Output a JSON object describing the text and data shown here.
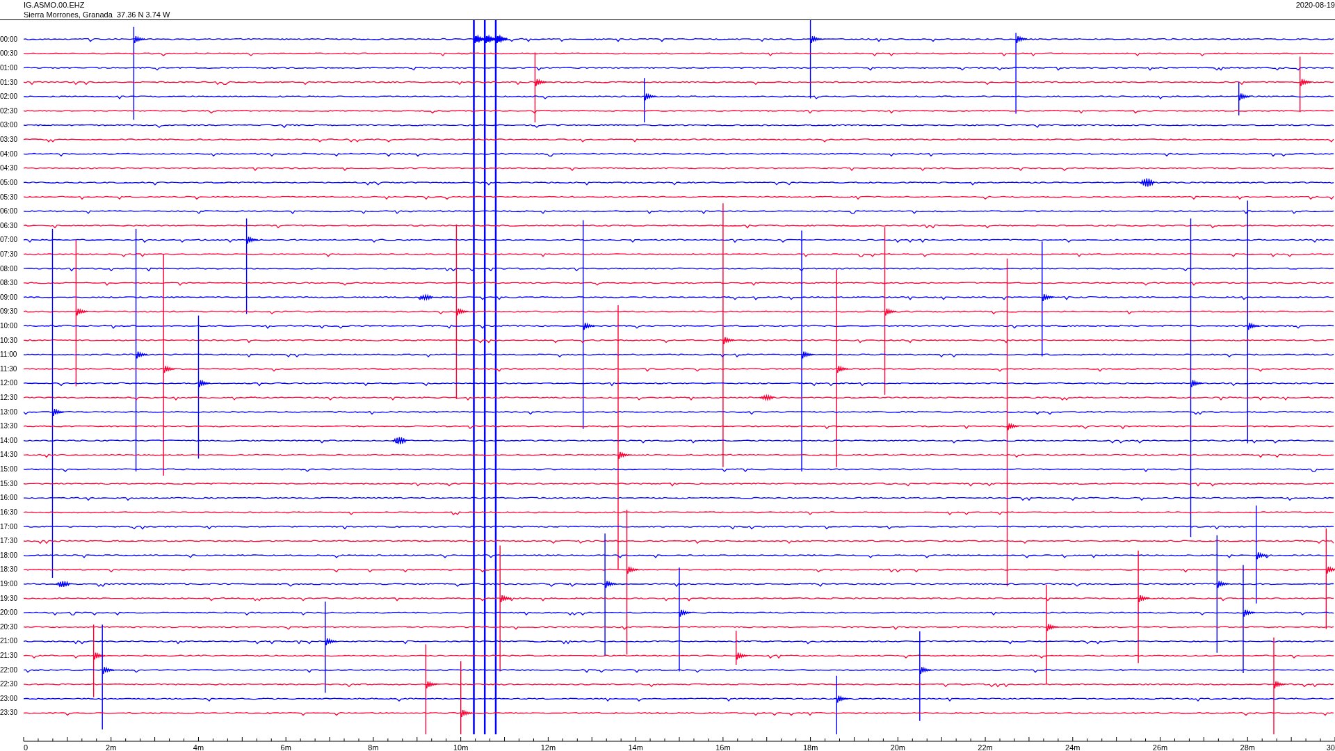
{
  "header": {
    "station": "IG.ASMO.00.EHZ",
    "location": "Sierra Morrones, Granada  37.36 N 3.74 W",
    "date": "2020-08-19"
  },
  "rows": [
    {
      "label": "00:00",
      "color": "#0000ff"
    },
    {
      "label": "00:30",
      "color": "#ff0033"
    },
    {
      "label": "01:00",
      "color": "#0000ff"
    },
    {
      "label": "01:30",
      "color": "#ff0033"
    },
    {
      "label": "02:00",
      "color": "#0000ff"
    },
    {
      "label": "02:30",
      "color": "#ff0033"
    },
    {
      "label": "03:00",
      "color": "#0000ff"
    },
    {
      "label": "03:30",
      "color": "#ff0033"
    },
    {
      "label": "04:00",
      "color": "#0000ff"
    },
    {
      "label": "04:30",
      "color": "#ff0033"
    },
    {
      "label": "05:00",
      "color": "#0000ff"
    },
    {
      "label": "05:30",
      "color": "#ff0033"
    },
    {
      "label": "06:00",
      "color": "#0000ff"
    },
    {
      "label": "06:30",
      "color": "#ff0033"
    },
    {
      "label": "07:00",
      "color": "#0000ff"
    },
    {
      "label": "07:30",
      "color": "#ff0033"
    },
    {
      "label": "08:00",
      "color": "#0000ff"
    },
    {
      "label": "08:30",
      "color": "#ff0033"
    },
    {
      "label": "09:00",
      "color": "#0000ff"
    },
    {
      "label": "09:30",
      "color": "#ff0033"
    },
    {
      "label": "10:00",
      "color": "#0000ff"
    },
    {
      "label": "10:30",
      "color": "#ff0033"
    },
    {
      "label": "11:00",
      "color": "#0000ff"
    },
    {
      "label": "11:30",
      "color": "#ff0033"
    },
    {
      "label": "12:00",
      "color": "#0000ff"
    },
    {
      "label": "12:30",
      "color": "#ff0033"
    },
    {
      "label": "13:00",
      "color": "#0000ff"
    },
    {
      "label": "13:30",
      "color": "#ff0033"
    },
    {
      "label": "14:00",
      "color": "#0000ff"
    },
    {
      "label": "14:30",
      "color": "#ff0033"
    },
    {
      "label": "15:00",
      "color": "#0000ff"
    },
    {
      "label": "15:30",
      "color": "#ff0033"
    },
    {
      "label": "16:00",
      "color": "#0000ff"
    },
    {
      "label": "16:30",
      "color": "#ff0033"
    },
    {
      "label": "17:00",
      "color": "#0000ff"
    },
    {
      "label": "17:30",
      "color": "#ff0033"
    },
    {
      "label": "18:00",
      "color": "#0000ff"
    },
    {
      "label": "18:30",
      "color": "#ff0033"
    },
    {
      "label": "19:00",
      "color": "#0000ff"
    },
    {
      "label": "19:30",
      "color": "#ff0033"
    },
    {
      "label": "20:00",
      "color": "#0000ff"
    },
    {
      "label": "20:30",
      "color": "#ff0033"
    },
    {
      "label": "21:00",
      "color": "#0000ff"
    },
    {
      "label": "21:30",
      "color": "#ff0033"
    },
    {
      "label": "22:00",
      "color": "#0000ff"
    },
    {
      "label": "22:30",
      "color": "#ff0033"
    },
    {
      "label": "23:00",
      "color": "#0000ff"
    },
    {
      "label": "23:30",
      "color": "#ff0033"
    }
  ],
  "axis": {
    "labels": [
      "0",
      "2m",
      "4m",
      "6m",
      "8m",
      "10m",
      "12m",
      "14m",
      "16m",
      "18m",
      "20m",
      "22m",
      "24m",
      "26m",
      "28m",
      "30"
    ]
  }
}
